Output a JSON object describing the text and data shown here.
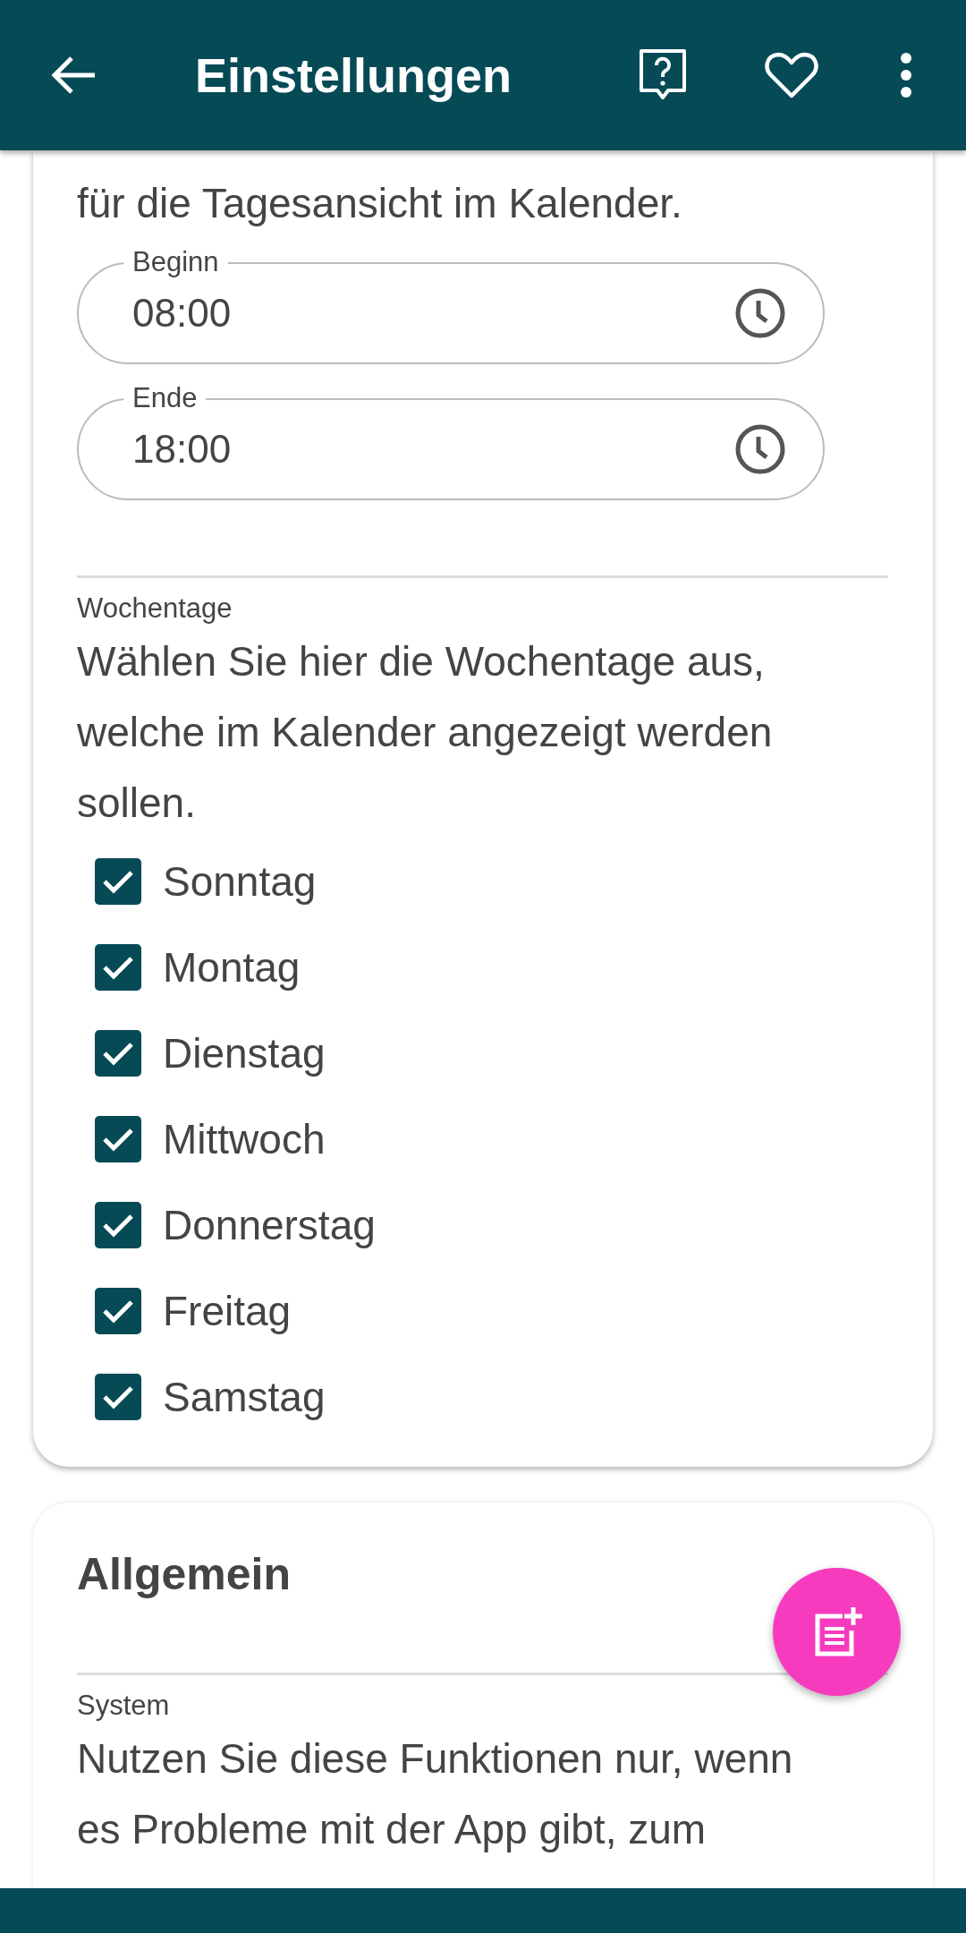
{
  "app_bar": {
    "title": "Einstellungen"
  },
  "calendar_card": {
    "intro_tail": "für die Tagesansicht im Kalender.",
    "time_fields": [
      {
        "label": "Beginn",
        "value": "08:00"
      },
      {
        "label": "Ende",
        "value": "18:00"
      }
    ],
    "weekdays": {
      "label": "Wochentage",
      "description": "Wählen Sie hier die Wochentage aus, welche im Kalender angezeigt werden sollen.",
      "days": [
        {
          "label": "Sonntag",
          "checked": true
        },
        {
          "label": "Montag",
          "checked": true
        },
        {
          "label": "Dienstag",
          "checked": true
        },
        {
          "label": "Mittwoch",
          "checked": true
        },
        {
          "label": "Donnerstag",
          "checked": true
        },
        {
          "label": "Freitag",
          "checked": true
        },
        {
          "label": "Samstag",
          "checked": true
        }
      ]
    }
  },
  "general_card": {
    "title": "Allgemein",
    "system": {
      "label": "System",
      "description": "Nutzen Sie diese Funktionen nur, wenn es Probleme mit der App gibt, zum"
    }
  }
}
